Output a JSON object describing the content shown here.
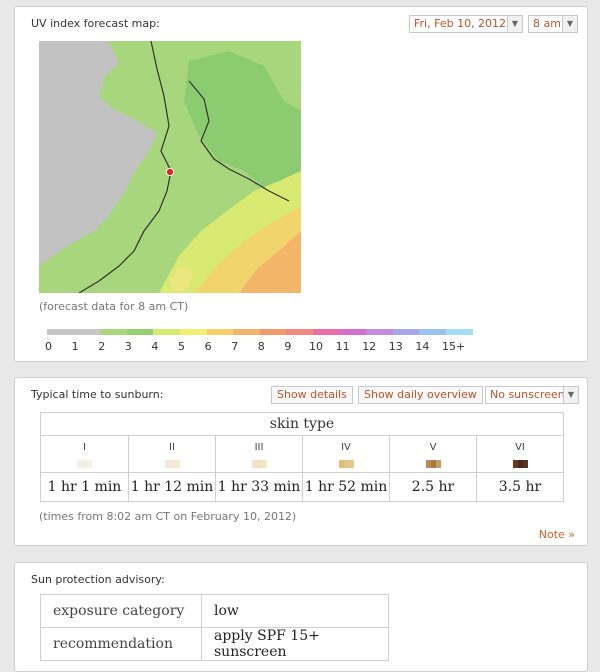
{
  "forecast": {
    "title": "UV index forecast map:",
    "date_select": "Fri, Feb 10, 2012",
    "hour_select": "8 am",
    "map_caption": "(forecast data for 8 am CT)",
    "legend_labels": [
      "0",
      "1",
      "2",
      "3",
      "4",
      "5",
      "6",
      "7",
      "8",
      "9",
      "10",
      "11",
      "12",
      "13",
      "14",
      "15+"
    ],
    "legend_colors": [
      "#c6c6c6",
      "#c6c6c6",
      "#aad67e",
      "#97cf73",
      "#d4ea70",
      "#f3ef72",
      "#f4cf6a",
      "#f4b36a",
      "#f39a6c",
      "#f08a80",
      "#ea6fa6",
      "#d46fcc",
      "#c48be0",
      "#a7a7ea",
      "#99c3ee",
      "#a5dcef"
    ]
  },
  "sunburn": {
    "title": "Typical time to sunburn:",
    "show_details": "Show details",
    "show_daily": "Show daily overview",
    "sunscreen_select": "No sunscreen",
    "skin_type_header": "skin type",
    "types": [
      {
        "label": "I",
        "time": "1 hr 1 min",
        "swatch": [
          "#f3efe9",
          "#f6eede",
          "#f9f1e1"
        ]
      },
      {
        "label": "II",
        "time": "1 hr 12 min",
        "swatch": [
          "#f2e8dc",
          "#f4e6d2",
          "#f6ead8"
        ]
      },
      {
        "label": "III",
        "time": "1 hr 33 min",
        "swatch": [
          "#f1e2c9",
          "#f3e3c6",
          "#f5e6cb"
        ]
      },
      {
        "label": "IV",
        "time": "1 hr 52 min",
        "swatch": [
          "#dcc07a",
          "#e2c685",
          "#e5ca8c"
        ]
      },
      {
        "label": "V",
        "time": "2.5 hr",
        "swatch": [
          "#b98a52",
          "#a97840",
          "#c89a62"
        ]
      },
      {
        "label": "VI",
        "time": "3.5 hr",
        "swatch": [
          "#6a3a24",
          "#4e2a1a",
          "#5c3222"
        ]
      }
    ],
    "times_caption": "(times from 8:02 am CT on February 10, 2012)",
    "note_link": "Note »"
  },
  "advisory": {
    "title": "Sun protection advisory:",
    "rows": [
      {
        "key": "exposure category",
        "value": "low"
      },
      {
        "key": "recommendation",
        "value": "apply SPF 15+ sunscreen"
      }
    ]
  }
}
